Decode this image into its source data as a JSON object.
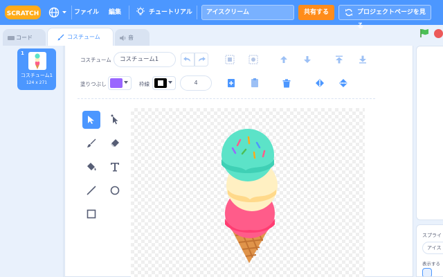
{
  "menubar": {
    "logo_text": "SCRATCH",
    "file": "ファイル",
    "edit": "編集",
    "tutorial": "チュートリアル",
    "project_title": "アイスクリーム",
    "share": "共有する",
    "project_page": "プロジェクトページを見る"
  },
  "tabs": {
    "code": "コード",
    "costume": "コスチューム",
    "sound": "音"
  },
  "costume_list": {
    "items": [
      {
        "number": "1",
        "name": "コスチューム1",
        "size": "124 x 271"
      }
    ]
  },
  "editor": {
    "costume_label": "コスチューム",
    "costume_name": "コスチューム1",
    "fill_label": "塗りつぶし",
    "fill_color": "#9966ff",
    "outline_label": "枠線",
    "outline_color": "#000000",
    "outline_width": "4"
  },
  "sprite_pane": {
    "sprite_label": "スプライト",
    "sprite_name": "アイス",
    "show_label": "表示する"
  },
  "colors": {
    "accent": "#4c97ff",
    "share": "#ff8c1a",
    "flag": "#4cbf56",
    "stop": "#ec5959"
  }
}
